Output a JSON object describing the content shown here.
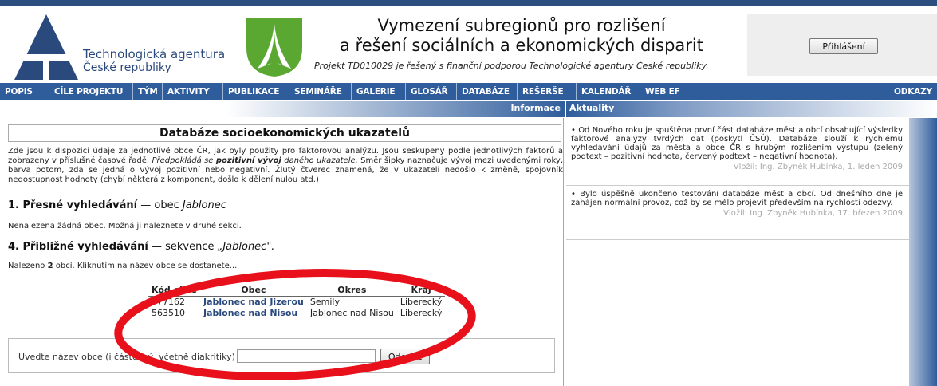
{
  "header": {
    "agency_name": "Technologická agentura",
    "agency_sub": "České republiky",
    "title_line1": "Vymezení subregionů pro rozlišení",
    "title_line2": "a řešení sociálních a ekonomických disparit",
    "subtitle": "Projekt TD010029 je řešený s finanční podporou Technologické agentury České republiky.",
    "login_label": "Přihlášení"
  },
  "nav": {
    "items": [
      "POPIS",
      "CÍLE PROJEKTU",
      "TÝM",
      "AKTIVITY",
      "PUBLIKACE",
      "SEMINÁŘE",
      "GALERIE",
      "GLOSÁŘ",
      "DATABÁZE",
      "REŠERŠE",
      "KALENDÁŘ",
      "WEB EF",
      "ODKAZY"
    ]
  },
  "subbar": {
    "left": "Informace",
    "right": "Aktuality"
  },
  "main": {
    "section_title": "Databáze socioekonomických ukazatelů",
    "intro_a": "Zde jsou k dispozici údaje za jednotlivé obce ČR, jak byly použity pro faktorovou analýzu. Jsou seskupeny podle jednotlivých faktorů a zobrazeny v příslušné časové řadě. ",
    "intro_b": "Předpokládá se ",
    "intro_c": "pozitivní vývoj",
    "intro_d": " daného ukazatele.",
    "intro_e": " Směr šipky naznačuje vývoj mezi uvedenými roky, barva potom, zda se jedná o vývoj pozitivní nebo negativní. Žlutý čtverec znamená, že v ukazateli nedošlo k změně, spojovník nedostupnost hodnoty (chybí některá z komponent, došlo k dělení nulou atd.)",
    "exact_heading": "1. Přesné vyhledávání",
    "exact_rest": " — obec ",
    "exact_name": "Jablonec",
    "not_found": "Nenalezena žádná obec. Možná ji naleznete v druhé sekci.",
    "approx_heading": "4. Přibližné vyhledávání",
    "approx_rest": " — sekvence ",
    "approx_name": "„Jablonec\".",
    "found_a": "Nalezeno ",
    "found_count": "2",
    "found_b": " obcí. Kliknutím na název obce se dostanete..."
  },
  "table": {
    "headers": [
      "Kód obce",
      "Obec",
      "Okres",
      "Kraj"
    ],
    "rows": [
      [
        "577162",
        "Jablonec nad Jizerou",
        "Semily",
        "Liberecký"
      ],
      [
        "563510",
        "Jablonec nad Nisou",
        "Jablonec nad Nisou",
        "Liberecký"
      ]
    ]
  },
  "search": {
    "label": "Uveďte název obce (i částečný, včetně diakritiky)",
    "value": "",
    "button": "Odeslat"
  },
  "news": [
    {
      "text": "• Od Nového roku je spuštěna první část databáze měst a obcí obsahující výsledky faktorové analýzy tvrdých dat (poskytl ČSÚ). Databáze slouží k rychlému vyhledávání údajů za města a obce ČR s hrubým rozlišením výstupu (zelený podtext – pozitivní hodnota, červený podtext – negativní hodnota).",
      "by": "Vložil: Ing. Zbyněk Hubínka, 1. leden 2009"
    },
    {
      "text": "• Bylo úspěšně ukončeno testování databáze měst a obcí. Od dnešního dne je zahájen normální provoz, což by se mělo projevit především na rychlosti odezvy.",
      "by": "Vložil: Ing. Zbyněk Hubínka, 17. březen 2009"
    }
  ],
  "colors": {
    "nav_bg": "#2f5d9c",
    "brand_blue": "#2a4a7d",
    "ef_green": "#5aa832",
    "annotation_red": "#e8101a"
  }
}
